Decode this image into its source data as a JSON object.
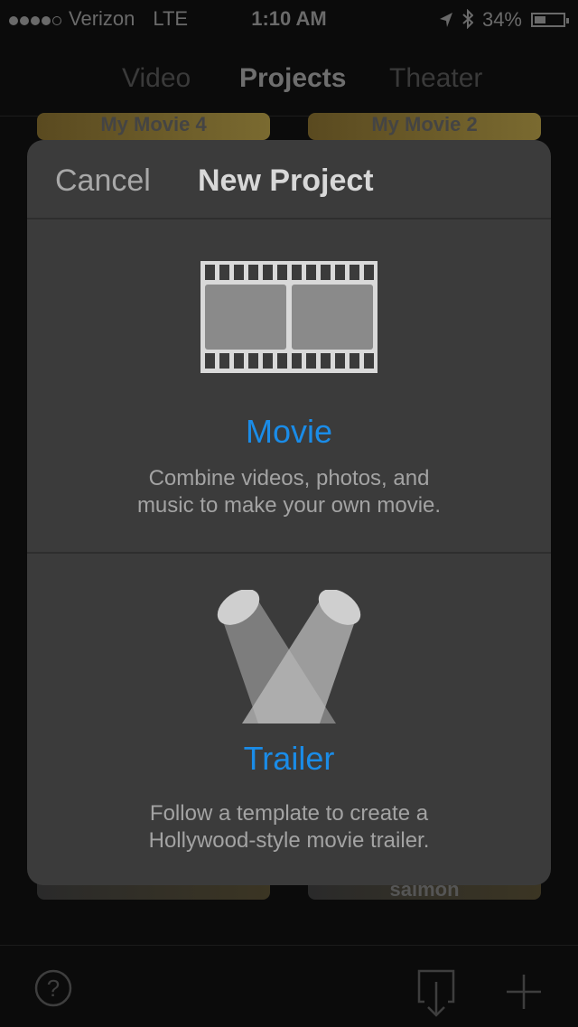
{
  "status_bar": {
    "carrier": "Verizon",
    "network": "LTE",
    "time": "1:10 AM",
    "battery": "34%",
    "signal_bars": 4
  },
  "nav": {
    "tabs": [
      "Video",
      "Projects",
      "Theater"
    ],
    "active_tab": "Projects"
  },
  "background_projects": [
    "My Movie 4",
    "My Movie 2",
    "",
    "salmon"
  ],
  "modal": {
    "cancel_label": "Cancel",
    "title": "New Project",
    "options": [
      {
        "label": "Movie",
        "description_line1": "Combine videos, photos, and",
        "description_line2": "music to make your own movie.",
        "icon": "film-strip-icon"
      },
      {
        "label": "Trailer",
        "description_line1": "Follow a template to create a",
        "description_line2": "Hollywood-style movie trailer.",
        "icon": "spotlights-icon"
      }
    ]
  },
  "toolbar": {
    "help_icon": "question-mark",
    "import_icon": "download-tray",
    "add_icon": "plus"
  },
  "colors": {
    "accent": "#1a8ce8",
    "modal_bg": "#3b3b3b",
    "background": "#0b0b0b"
  }
}
